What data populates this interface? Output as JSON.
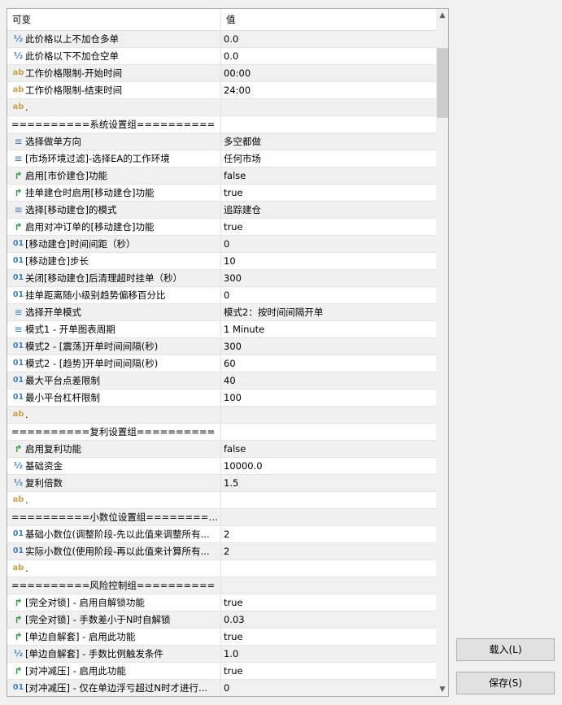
{
  "header": {
    "col_name": "可变",
    "col_value": "值"
  },
  "rows": [
    {
      "icon": "half",
      "name": "此价格以上不加仓多单",
      "value": "0.0"
    },
    {
      "icon": "half",
      "name": "此价格以下不加仓空单",
      "value": "0.0"
    },
    {
      "icon": "ab",
      "name": "工作价格限制-开始时间",
      "value": "00:00"
    },
    {
      "icon": "ab",
      "name": "工作价格限制-结束时间",
      "value": "24:00"
    },
    {
      "icon": "ab",
      "name": ".",
      "value": ""
    },
    {
      "icon": "none",
      "name": "==========系统设置组==========",
      "value": ""
    },
    {
      "icon": "list",
      "name": "选择做单方向",
      "value": "多空都做"
    },
    {
      "icon": "list",
      "name": "[市场环境过滤]-选择EA的工作环境",
      "value": "任何市场"
    },
    {
      "icon": "bool",
      "name": "启用[市价建仓]功能",
      "value": "false"
    },
    {
      "icon": "bool",
      "name": "挂单建仓时启用[移动建仓]功能",
      "value": "true"
    },
    {
      "icon": "list",
      "name": "选择[移动建仓]的模式",
      "value": "追踪建仓"
    },
    {
      "icon": "bool",
      "name": "启用对冲订单的[移动建仓]功能",
      "value": "true"
    },
    {
      "icon": "01",
      "name": "[移动建仓]时间间距（秒）",
      "value": "0"
    },
    {
      "icon": "01",
      "name": "[移动建仓]步长",
      "value": "10"
    },
    {
      "icon": "01",
      "name": "关闭[移动建仓]后清理超时挂单（秒）",
      "value": "300"
    },
    {
      "icon": "01",
      "name": "挂单距离随小级别趋势偏移百分比",
      "value": "0"
    },
    {
      "icon": "list",
      "name": "选择开单模式",
      "value": "模式2：按时间间隔开单"
    },
    {
      "icon": "list",
      "name": "模式1 - 开单图表周期",
      "value": "1 Minute"
    },
    {
      "icon": "01",
      "name": "模式2 - [震荡]开单时间间隔(秒)",
      "value": "300"
    },
    {
      "icon": "01",
      "name": "模式2 - [趋势]开单时间间隔(秒)",
      "value": "60"
    },
    {
      "icon": "01",
      "name": "最大平台点差限制",
      "value": "40"
    },
    {
      "icon": "01",
      "name": "最小平台杠杆限制",
      "value": "100"
    },
    {
      "icon": "ab",
      "name": ".",
      "value": ""
    },
    {
      "icon": "none",
      "name": "==========复利设置组==========",
      "value": ""
    },
    {
      "icon": "bool",
      "name": "启用复利功能",
      "value": "false"
    },
    {
      "icon": "half",
      "name": "基础资金",
      "value": "10000.0"
    },
    {
      "icon": "half",
      "name": "复利倍数",
      "value": "1.5"
    },
    {
      "icon": "ab",
      "name": ".",
      "value": ""
    },
    {
      "icon": "none",
      "name": "==========小数位设置组==========",
      "value": ""
    },
    {
      "icon": "01",
      "name": "基础小数位(调整阶段-先以此值来调整所有...",
      "value": "2"
    },
    {
      "icon": "01",
      "name": "实际小数位(使用阶段-再以此值来计算所有...",
      "value": "2"
    },
    {
      "icon": "ab",
      "name": ".",
      "value": ""
    },
    {
      "icon": "none",
      "name": "==========风险控制组==========",
      "value": ""
    },
    {
      "icon": "bool",
      "name": "[完全对锁] - 启用自解锁功能",
      "value": "true"
    },
    {
      "icon": "bool",
      "name": "[完全对锁] - 手数差小于N时自解锁",
      "value": "0.03"
    },
    {
      "icon": "bool",
      "name": "[单边自解套] - 启用此功能",
      "value": "true"
    },
    {
      "icon": "half",
      "name": "[单边自解套] - 手数比例触发条件",
      "value": "1.0"
    },
    {
      "icon": "bool",
      "name": "[对冲减压] - 启用此功能",
      "value": "true"
    },
    {
      "icon": "01",
      "name": "[对冲减压] - 仅在单边浮亏超过N时才进行...",
      "value": "0"
    }
  ],
  "icons": {
    "half": "fraction-half-icon",
    "ab": "text-ab-icon",
    "01": "integer-01-icon",
    "list": "enum-list-icon",
    "bool": "boolean-arrow-icon"
  },
  "buttons": {
    "load": "载入(L)",
    "save": "保存(S)"
  },
  "scrollbar": {
    "position": 0.06,
    "visible_fraction": 0.11
  }
}
